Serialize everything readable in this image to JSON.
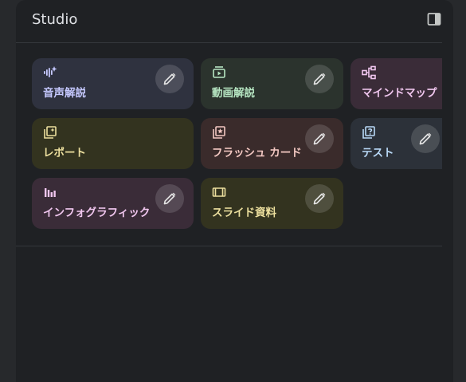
{
  "studio": {
    "title": "Studio",
    "panel_toggle_icon": "side-panel-icon"
  },
  "tiles": [
    {
      "id": "audio",
      "label": "音声解説",
      "icon": "waveform-icon",
      "color": "#c6c9ff",
      "bg": "#2f323f"
    },
    {
      "id": "video",
      "label": "動画解説",
      "icon": "video-icon",
      "color": "#b7e7c3",
      "bg": "#2b332d"
    },
    {
      "id": "mindmap",
      "label": "マインドマップ",
      "icon": "mindmap-icon",
      "color": "#f0c6ee",
      "bg": "#3a2c38"
    },
    {
      "id": "report",
      "label": "レポート",
      "icon": "report-icon",
      "color": "#ecdf9e",
      "bg": "#33331f"
    },
    {
      "id": "flashcard",
      "label": "フラッシュ カード",
      "icon": "flashcard-icon",
      "color": "#f3c8c2",
      "bg": "#3a2b2b"
    },
    {
      "id": "quiz",
      "label": "テスト",
      "icon": "quiz-icon",
      "color": "#b9d9f7",
      "bg": "#2c3139"
    },
    {
      "id": "infographic",
      "label": "インフォグラフィック",
      "icon": "bar-chart-icon",
      "color": "#f0c6ee",
      "bg": "#3a2c38"
    },
    {
      "id": "slides",
      "label": "スライド資料",
      "icon": "slides-icon",
      "color": "#ecdf9e",
      "bg": "#33331f"
    }
  ],
  "edit_icon": "pencil-icon"
}
